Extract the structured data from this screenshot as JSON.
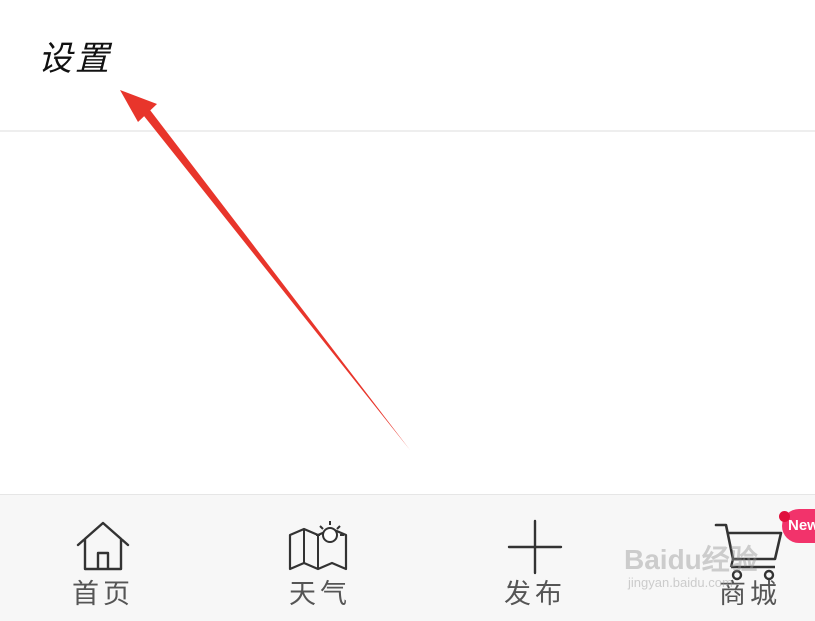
{
  "header": {
    "title": "设置"
  },
  "tab_bar": {
    "items": [
      {
        "label": "首页",
        "icon": "home-icon"
      },
      {
        "label": "天气",
        "icon": "weather-map-icon"
      },
      {
        "label": "发布",
        "icon": "plus-icon"
      },
      {
        "label": "商城",
        "icon": "shopping-cart-icon"
      }
    ],
    "badge": "New"
  },
  "watermark": {
    "logo": "Baidu经验",
    "sub": "jingyan.baidu.com"
  },
  "colors": {
    "arrow": "#e8352b",
    "badge": "#f2336b",
    "icon": "#333333",
    "label": "#555555"
  }
}
